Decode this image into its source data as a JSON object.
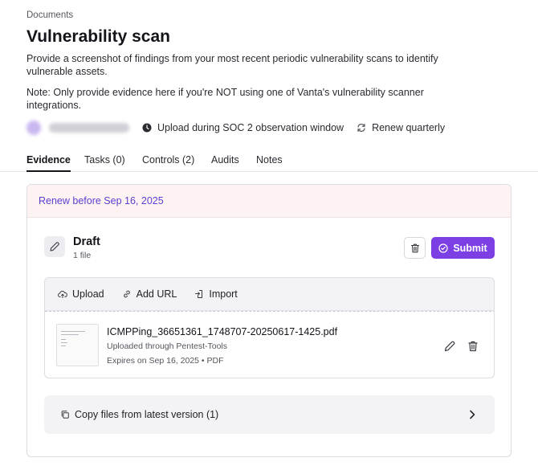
{
  "breadcrumb": "Documents",
  "title": "Vulnerability scan",
  "description": "Provide a screenshot of findings from your most recent periodic vulnerability scans to identify vulnerable assets.",
  "note": "Note: Only provide evidence here if you're NOT using one of Vanta's vulnerability scanner integrations.",
  "meta": {
    "upload_window": "Upload during SOC 2 observation window",
    "renew_frequency": "Renew quarterly"
  },
  "tabs": [
    {
      "label": "Evidence",
      "active": true
    },
    {
      "label": "Tasks (0)"
    },
    {
      "label": "Controls (2)"
    },
    {
      "label": "Audits"
    },
    {
      "label": "Notes"
    }
  ],
  "card": {
    "renew_banner": "Renew before Sep 16, 2025",
    "draft_title": "Draft",
    "draft_count": "1 file",
    "submit_label": "Submit",
    "toolbar": {
      "upload": "Upload",
      "add_url": "Add URL",
      "import": "Import"
    },
    "file": {
      "name": "ICMPPing_36651361_1748707-20250617-1425.pdf",
      "source": "Uploaded through Pentest-Tools",
      "expires": "Expires on Sep 16, 2025 • PDF"
    },
    "copy_label": "Copy files from latest version (1)"
  },
  "colors": {
    "accent": "#7b3fe4",
    "banner_bg": "#fdf3f3",
    "banner_text": "#5b3fd1"
  }
}
